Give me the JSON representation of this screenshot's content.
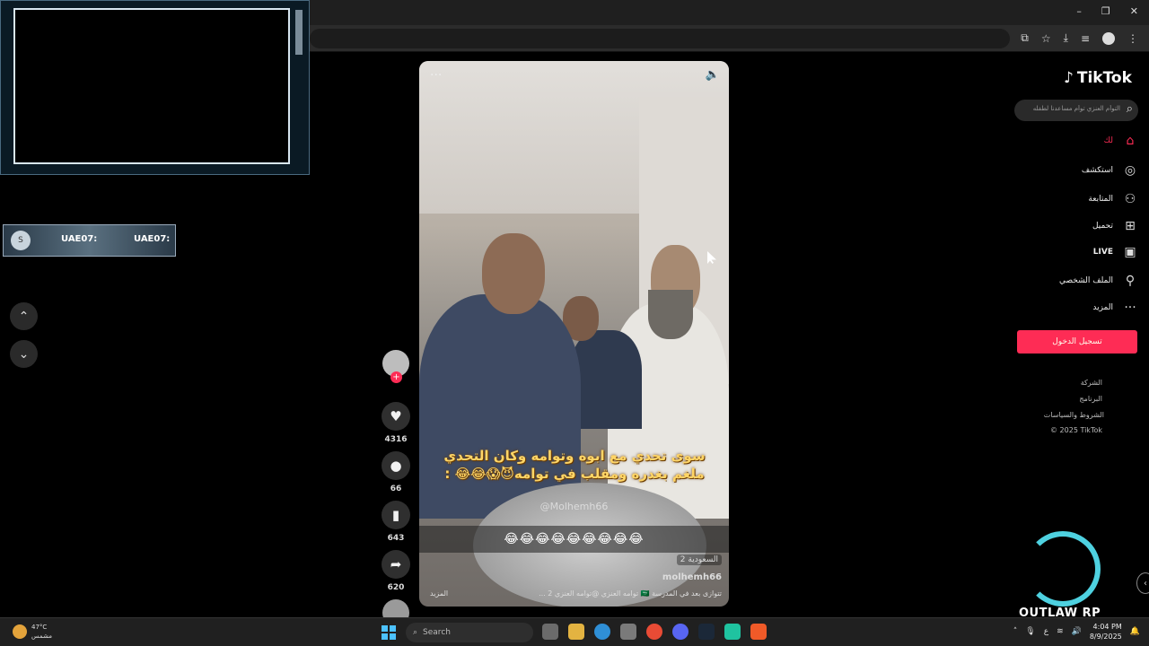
{
  "window": {
    "minimize": "–",
    "restore": "❐",
    "close": "✕"
  },
  "toolbar": {
    "icons": [
      "install-icon",
      "star-icon",
      "download-icon",
      "playlist-icon",
      "profile-icon",
      "menu-icon"
    ]
  },
  "overlay": {
    "hud_circle": "S",
    "hud_text_1": "UAE07:",
    "hud_text_2": "UAE07:"
  },
  "nav": {
    "up": "⌃",
    "down": "⌄"
  },
  "video": {
    "caption_line1": "سوى تحدي مع ابوه وتوامه وكان التحدي",
    "caption_line2": "ملغم بغدره ومقلب في توامه😈😱😂😂 :",
    "watermark": "@Molhemh66",
    "emoji_strip": "😂😂😂😂😂😂😂😂😂",
    "country": "السعودية 2",
    "author": "molhemh66",
    "description": "تتوازى بعد في المدرسة 🇸🇦 توامه العنزي @توامه العنزي 2 ...",
    "more": "المزيد"
  },
  "actions": {
    "likes": "4316",
    "comments": "66",
    "saves": "643",
    "shares": "620"
  },
  "tiktok": {
    "logo": "TikTok",
    "search_placeholder": "التوأم العنزي توأم مساعدنا لطفله",
    "nav": [
      {
        "label": "لك",
        "icon": "home-icon"
      },
      {
        "label": "استكشف",
        "icon": "compass-icon"
      },
      {
        "label": "المتابعة",
        "icon": "user-plus-icon"
      },
      {
        "label": "تحميل",
        "icon": "plus-square-icon"
      },
      {
        "label": "LIVE",
        "icon": "live-icon"
      },
      {
        "label": "الملف الشخصي",
        "icon": "user-icon"
      },
      {
        "label": "المزيد",
        "icon": "more-icon"
      }
    ],
    "login": "تسجيل الدخول",
    "footer": [
      "الشركة",
      "البرنامج",
      "الشروط والسياسات",
      "© 2025 TikTok"
    ]
  },
  "brand": {
    "text": "OUTLAW RP"
  },
  "taskbar": {
    "weather_temp": "47°C",
    "weather_desc": "مشمس",
    "weather_badge": "3",
    "search_label": "Search",
    "time": "4:04 PM",
    "date": "8/9/2025",
    "lang": "ع"
  },
  "colors": {
    "accent": "#fe2c55",
    "brand": "#4ed1e0",
    "start": "#4cc2ff"
  }
}
